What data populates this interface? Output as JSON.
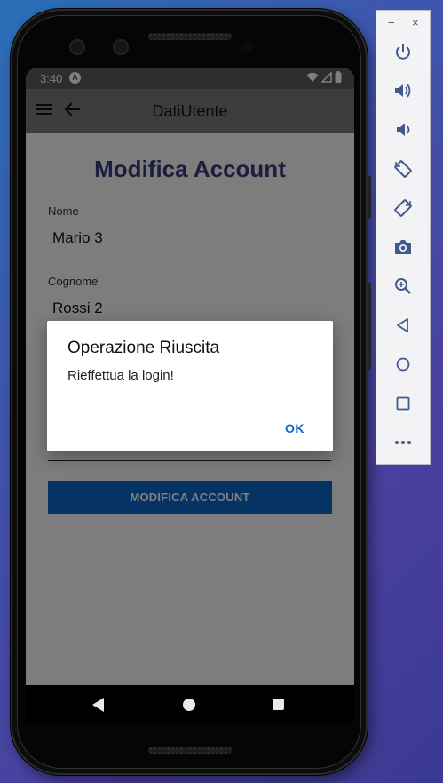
{
  "status_bar": {
    "time": "3:40",
    "badge": "A"
  },
  "app_bar": {
    "title": "DatiUtente"
  },
  "form": {
    "page_title": "Modifica Account",
    "fields": [
      {
        "label": "Nome",
        "value": "Mario 3"
      },
      {
        "label": "Cognome",
        "value": "Rossi 2"
      }
    ],
    "submit_label": "MODIFICA ACCOUNT"
  },
  "dialog": {
    "title": "Operazione Riuscita",
    "message": "Rieffettua la login!",
    "ok_label": "OK"
  },
  "emulator_toolbar": {
    "window_controls": [
      "−",
      "×"
    ],
    "tools": [
      "power-icon",
      "volume-up-icon",
      "volume-down-icon",
      "rotate-left-icon",
      "rotate-right-icon",
      "camera-icon",
      "zoom-icon",
      "back-icon",
      "home-icon",
      "overview-icon",
      "more-icon"
    ]
  },
  "colors": {
    "accent": "#0b66c8",
    "title": "#3a3a80",
    "scrim": "rgba(0,0,0,0.5)"
  }
}
